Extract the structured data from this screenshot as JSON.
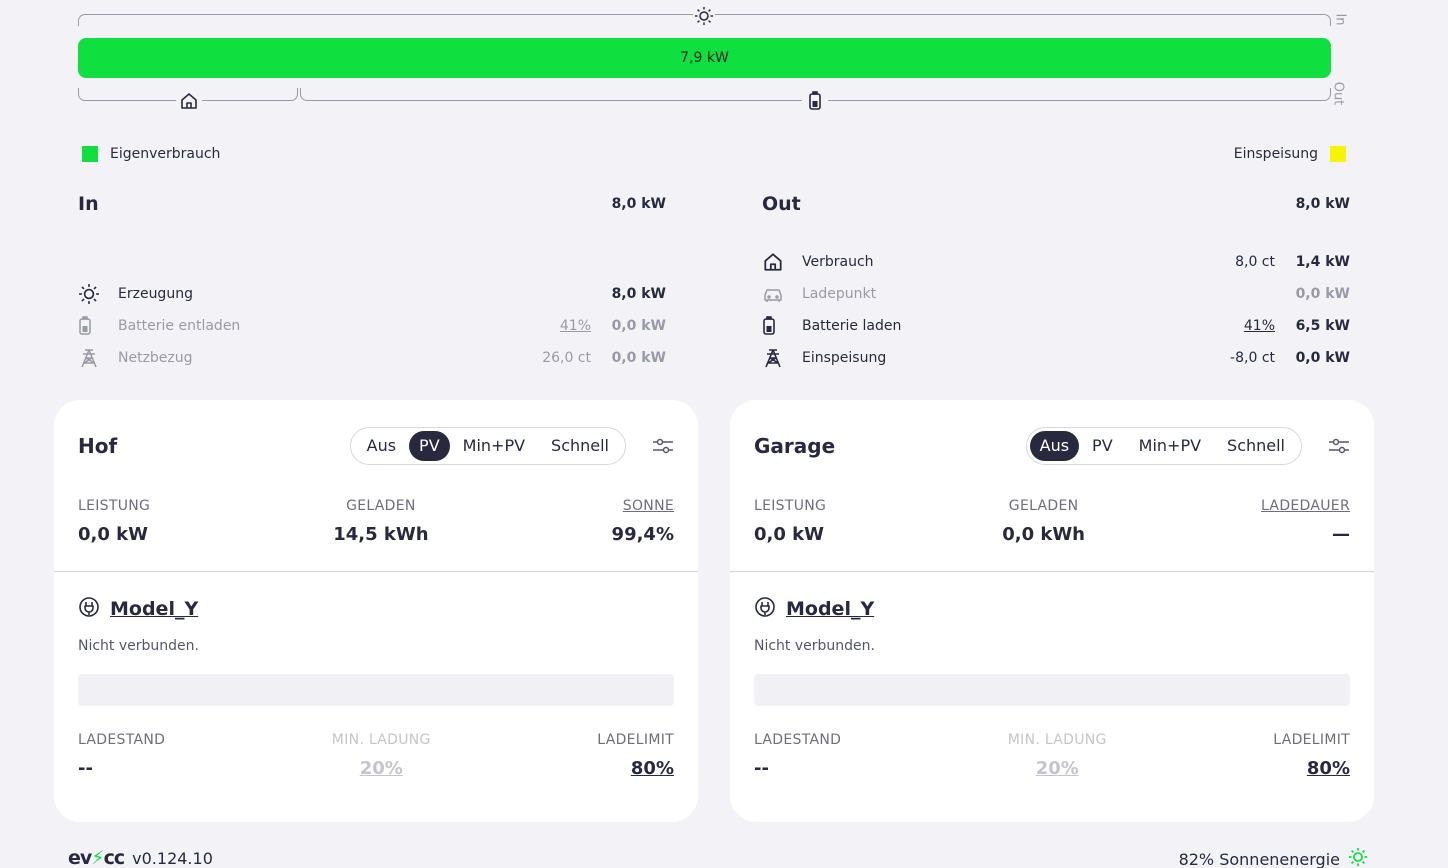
{
  "flow": {
    "bar_value": "7,9 kW",
    "in_label": "In",
    "out_label": "Out"
  },
  "legend": {
    "self_label": "Eigenverbrauch",
    "self_color": "#0fe040",
    "feed_label": "Einspeisung",
    "feed_color": "#f5f500"
  },
  "in": {
    "title": "In",
    "total": "8,0 kW",
    "rows": [
      {
        "icon": "sun-icon",
        "label": "Erzeugung",
        "pct": "",
        "price": "",
        "value": "8,0 kW"
      },
      {
        "icon": "battery-icon",
        "label": "Batterie entladen",
        "pct": "41%",
        "price": "",
        "value": "0,0 kW"
      },
      {
        "icon": "grid-tower-icon",
        "label": "Netzbezug",
        "pct": "",
        "price": "26,0 ct",
        "value": "0,0 kW"
      }
    ]
  },
  "out": {
    "title": "Out",
    "total": "8,0 kW",
    "rows": [
      {
        "icon": "house-icon",
        "label": "Verbrauch",
        "pct": "",
        "price": "8,0 ct",
        "value": "1,4 kW"
      },
      {
        "icon": "car-icon",
        "label": "Ladepunkt",
        "pct": "",
        "price": "",
        "value": "0,0 kW"
      },
      {
        "icon": "battery-icon",
        "label": "Batterie laden",
        "pct": "41%",
        "price": "",
        "value": "6,5 kW"
      },
      {
        "icon": "grid-tower-icon",
        "label": "Einspeisung",
        "pct": "",
        "price": "-8,0 ct",
        "value": "0,0 kW"
      }
    ]
  },
  "loadpoints": [
    {
      "title": "Hof",
      "modes": [
        "Aus",
        "PV",
        "Min+PV",
        "Schnell"
      ],
      "active_mode": "PV",
      "stats": {
        "power_label": "LEISTUNG",
        "power": "0,0 kW",
        "charged_label": "GELADEN",
        "charged": "14,5 kWh",
        "third_label": "SONNE",
        "third": "99,4%"
      },
      "vehicle": "Model_Y",
      "status": "Nicht verbunden.",
      "soc_label": "LADESTAND",
      "soc": "--",
      "min_label": "MIN. LADUNG",
      "min": "20%",
      "limit_label": "LADELIMIT",
      "limit": "80%"
    },
    {
      "title": "Garage",
      "modes": [
        "Aus",
        "PV",
        "Min+PV",
        "Schnell"
      ],
      "active_mode": "Aus",
      "stats": {
        "power_label": "LEISTUNG",
        "power": "0,0 kW",
        "charged_label": "GELADEN",
        "charged": "0,0 kWh",
        "third_label": "LADEDAUER",
        "third": "—"
      },
      "vehicle": "Model_Y",
      "status": "Nicht verbunden.",
      "soc_label": "LADESTAND",
      "soc": "--",
      "min_label": "MIN. LADUNG",
      "min": "20%",
      "limit_label": "LADELIMIT",
      "limit": "80%"
    }
  ],
  "footer": {
    "logo_a": "ev",
    "logo_b": "cc",
    "version": "v0.124.10",
    "solar": "82% Sonnenenergie"
  }
}
